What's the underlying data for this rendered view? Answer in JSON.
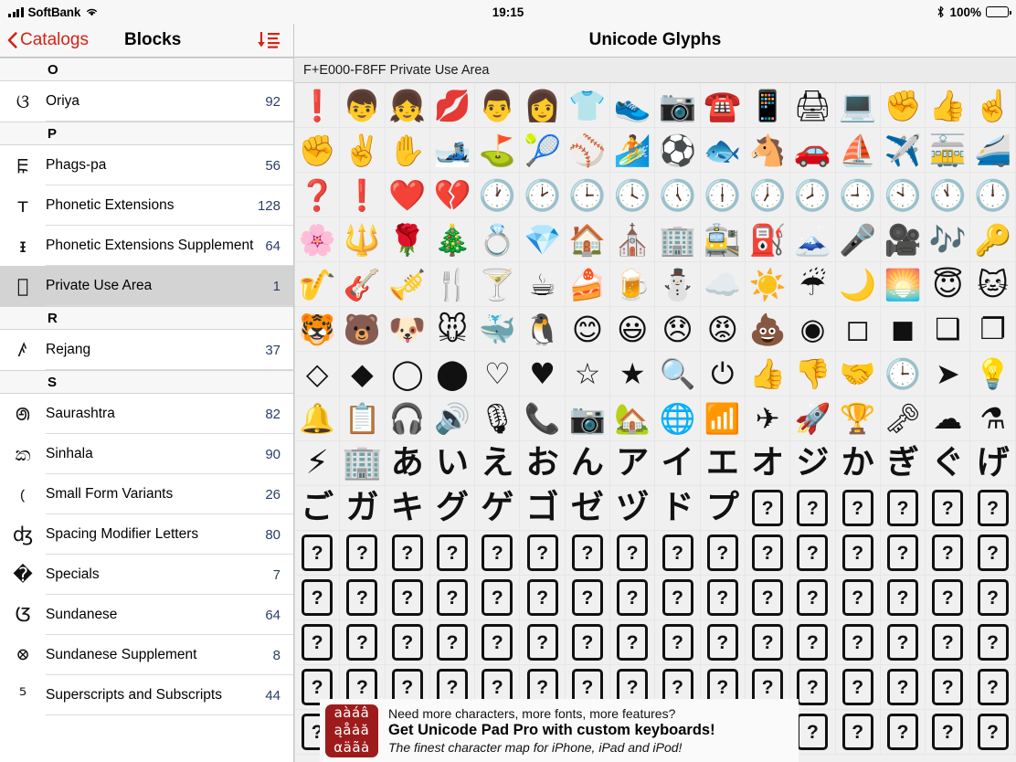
{
  "statusbar": {
    "signal_icon": "signal-bars-icon",
    "carrier": "SoftBank",
    "wifi_icon": "wifi-icon",
    "time": "19:15",
    "bluetooth_icon": "bluetooth-icon",
    "battery_percent": "100%",
    "battery_icon": "battery-full-icon"
  },
  "sidebar": {
    "back_label": "Catalogs",
    "back_icon": "chevron-left-icon",
    "title": "Blocks",
    "sort_icon": "sort-descending-icon",
    "sections": [
      {
        "letter": "O",
        "rows": [
          {
            "icon": "ଓ",
            "label": "Oriya",
            "count": "92",
            "selected": false
          }
        ]
      },
      {
        "letter": "P",
        "rows": [
          {
            "icon": "ꡀ",
            "label": "Phags-pa",
            "count": "56",
            "selected": false
          },
          {
            "icon": "ᴛ",
            "label": "Phonetic Extensions",
            "count": "128",
            "selected": false
          },
          {
            "icon": "ᵻ",
            "label": "Phonetic Extensions Supplement",
            "count": "64",
            "selected": false
          },
          {
            "icon": "",
            "label": "Private Use Area",
            "count": "1",
            "selected": true
          }
        ]
      },
      {
        "letter": "R",
        "rows": [
          {
            "icon": "ꤰ",
            "label": "Rejang",
            "count": "37",
            "selected": false
          }
        ]
      },
      {
        "letter": "S",
        "rows": [
          {
            "icon": "ꢠ",
            "label": "Saurashtra",
            "count": "82",
            "selected": false
          },
          {
            "icon": "ක",
            "label": "Sinhala",
            "count": "90",
            "selected": false
          },
          {
            "icon": "﹙",
            "label": "Small Form Variants",
            "count": "26",
            "selected": false
          },
          {
            "icon": "ʤ",
            "label": "Spacing Modifier Letters",
            "count": "80",
            "selected": false
          },
          {
            "icon": "�",
            "label": "Specials",
            "count": "7",
            "selected": false
          },
          {
            "icon": "ᮃ",
            "label": "Sundanese",
            "count": "64",
            "selected": false
          },
          {
            "icon": "᳁",
            "label": "Sundanese Supplement",
            "count": "8",
            "selected": false
          },
          {
            "icon": "⁵",
            "label": "Superscripts and Subscripts",
            "count": "44",
            "selected": false
          }
        ]
      }
    ]
  },
  "detail": {
    "title": "Unicode Glyphs",
    "block_header": "F+E000-F8FF Private Use Area",
    "columns": 16,
    "rows": 15,
    "glyphs": [
      {
        "ch": "❗",
        "style": "emoji",
        "name": "exclamation"
      },
      {
        "ch": "👦",
        "style": "emoji",
        "name": "boy"
      },
      {
        "ch": "👧",
        "style": "emoji",
        "name": "girl"
      },
      {
        "ch": "💋",
        "style": "emoji",
        "name": "kiss-mark"
      },
      {
        "ch": "👨",
        "style": "emoji",
        "name": "man"
      },
      {
        "ch": "👩",
        "style": "emoji",
        "name": "woman"
      },
      {
        "ch": "👕",
        "style": "emoji",
        "name": "t-shirt"
      },
      {
        "ch": "👟",
        "style": "emoji",
        "name": "running-shoe"
      },
      {
        "ch": "📷",
        "style": "emoji",
        "name": "camera"
      },
      {
        "ch": "☎️",
        "style": "emoji",
        "name": "telephone"
      },
      {
        "ch": "📱",
        "style": "emoji",
        "name": "mobile-phone"
      },
      {
        "ch": "🖨",
        "style": "emoji",
        "name": "printer"
      },
      {
        "ch": "💻",
        "style": "emoji",
        "name": "laptop"
      },
      {
        "ch": "✊",
        "style": "emoji",
        "name": "fist"
      },
      {
        "ch": "👍",
        "style": "emoji",
        "name": "thumbs-up"
      },
      {
        "ch": "☝️",
        "style": "emoji",
        "name": "index-pointing-up"
      },
      {
        "ch": "✊",
        "style": "emoji",
        "name": "raised-fist"
      },
      {
        "ch": "✌️",
        "style": "emoji",
        "name": "victory-hand"
      },
      {
        "ch": "✋",
        "style": "emoji",
        "name": "raised-hand"
      },
      {
        "ch": "🎿",
        "style": "emoji",
        "name": "skis"
      },
      {
        "ch": "⛳",
        "style": "emoji",
        "name": "golf-flag"
      },
      {
        "ch": "🎾",
        "style": "emoji",
        "name": "tennis-ball"
      },
      {
        "ch": "⚾",
        "style": "emoji",
        "name": "baseball"
      },
      {
        "ch": "🏄",
        "style": "emoji",
        "name": "surfer"
      },
      {
        "ch": "⚽",
        "style": "emoji",
        "name": "soccer-ball"
      },
      {
        "ch": "🐟",
        "style": "emoji",
        "name": "fish"
      },
      {
        "ch": "🐴",
        "style": "emoji",
        "name": "horse-face"
      },
      {
        "ch": "🚗",
        "style": "emoji",
        "name": "car"
      },
      {
        "ch": "⛵",
        "style": "emoji",
        "name": "sailboat"
      },
      {
        "ch": "✈️",
        "style": "emoji",
        "name": "airplane"
      },
      {
        "ch": "🚋",
        "style": "emoji",
        "name": "tram"
      },
      {
        "ch": "🚄",
        "style": "emoji",
        "name": "bullet-train"
      },
      {
        "ch": "❓",
        "style": "emoji",
        "name": "question-mark"
      },
      {
        "ch": "❗",
        "style": "emoji",
        "name": "exclamation-mark"
      },
      {
        "ch": "❤️",
        "style": "emoji",
        "name": "red-heart"
      },
      {
        "ch": "💔",
        "style": "emoji",
        "name": "broken-heart"
      },
      {
        "ch": "🕐",
        "style": "emoji",
        "name": "clock-one"
      },
      {
        "ch": "🕑",
        "style": "emoji",
        "name": "clock-two"
      },
      {
        "ch": "🕒",
        "style": "emoji",
        "name": "clock-three"
      },
      {
        "ch": "🕓",
        "style": "emoji",
        "name": "clock-four"
      },
      {
        "ch": "🕔",
        "style": "emoji",
        "name": "clock-five"
      },
      {
        "ch": "🕕",
        "style": "emoji",
        "name": "clock-six"
      },
      {
        "ch": "🕖",
        "style": "emoji",
        "name": "clock-seven"
      },
      {
        "ch": "🕗",
        "style": "emoji",
        "name": "clock-eight"
      },
      {
        "ch": "🕘",
        "style": "emoji",
        "name": "clock-nine"
      },
      {
        "ch": "🕙",
        "style": "emoji",
        "name": "clock-ten"
      },
      {
        "ch": "🕚",
        "style": "emoji",
        "name": "clock-eleven"
      },
      {
        "ch": "🕛",
        "style": "emoji",
        "name": "clock-twelve"
      },
      {
        "ch": "🌸",
        "style": "emoji",
        "name": "cherry-blossom"
      },
      {
        "ch": "🔱",
        "style": "emoji",
        "name": "trident"
      },
      {
        "ch": "🌹",
        "style": "emoji",
        "name": "rose"
      },
      {
        "ch": "🎄",
        "style": "emoji",
        "name": "christmas-tree"
      },
      {
        "ch": "💍",
        "style": "emoji",
        "name": "ring"
      },
      {
        "ch": "💎",
        "style": "emoji",
        "name": "gem-stone"
      },
      {
        "ch": "🏠",
        "style": "emoji",
        "name": "house"
      },
      {
        "ch": "⛪",
        "style": "emoji",
        "name": "church"
      },
      {
        "ch": "🏢",
        "style": "emoji",
        "name": "office-building"
      },
      {
        "ch": "🚉",
        "style": "emoji",
        "name": "station"
      },
      {
        "ch": "⛽",
        "style": "emoji",
        "name": "fuel-pump"
      },
      {
        "ch": "🗻",
        "style": "emoji",
        "name": "mount-fuji"
      },
      {
        "ch": "🎤",
        "style": "emoji",
        "name": "microphone"
      },
      {
        "ch": "🎥",
        "style": "emoji",
        "name": "movie-camera"
      },
      {
        "ch": "🎶",
        "style": "emoji",
        "name": "musical-notes"
      },
      {
        "ch": "🔑",
        "style": "emoji",
        "name": "key"
      },
      {
        "ch": "🎷",
        "style": "emoji",
        "name": "saxophone"
      },
      {
        "ch": "🎸",
        "style": "emoji",
        "name": "guitar"
      },
      {
        "ch": "🎺",
        "style": "emoji",
        "name": "trumpet"
      },
      {
        "ch": "🍴",
        "style": "emoji",
        "name": "fork-and-knife"
      },
      {
        "ch": "🍸",
        "style": "emoji",
        "name": "cocktail-glass"
      },
      {
        "ch": "☕",
        "style": "emoji",
        "name": "hot-beverage"
      },
      {
        "ch": "🍰",
        "style": "emoji",
        "name": "shortcake"
      },
      {
        "ch": "🍺",
        "style": "emoji",
        "name": "beer-mug"
      },
      {
        "ch": "⛄",
        "style": "emoji",
        "name": "snowman"
      },
      {
        "ch": "☁️",
        "style": "emoji",
        "name": "cloud"
      },
      {
        "ch": "☀️",
        "style": "emoji",
        "name": "sun"
      },
      {
        "ch": "☔",
        "style": "emoji",
        "name": "umbrella-with-rain"
      },
      {
        "ch": "🌙",
        "style": "emoji",
        "name": "crescent-moon"
      },
      {
        "ch": "🌅",
        "style": "emoji",
        "name": "sunrise"
      },
      {
        "ch": "😇",
        "style": "emoji",
        "name": "angel-face"
      },
      {
        "ch": "🐱",
        "style": "emoji",
        "name": "cat-face"
      },
      {
        "ch": "🐯",
        "style": "emoji",
        "name": "tiger-face"
      },
      {
        "ch": "🐻",
        "style": "emoji",
        "name": "bear-face"
      },
      {
        "ch": "🐶",
        "style": "emoji",
        "name": "dog-face"
      },
      {
        "ch": "🐭",
        "style": "emoji",
        "name": "mouse-face"
      },
      {
        "ch": "🐳",
        "style": "emoji",
        "name": "whale"
      },
      {
        "ch": "🐧",
        "style": "emoji",
        "name": "penguin"
      },
      {
        "ch": "😊",
        "style": "emoji",
        "name": "smiling-face"
      },
      {
        "ch": "😃",
        "style": "emoji",
        "name": "grinning-face"
      },
      {
        "ch": "😞",
        "style": "emoji",
        "name": "disappointed-face"
      },
      {
        "ch": "😡",
        "style": "emoji",
        "name": "angry-face"
      },
      {
        "ch": "💩",
        "style": "emoji",
        "name": "pile-of-poo"
      },
      {
        "ch": "◉",
        "style": "mono",
        "name": "fisheye"
      },
      {
        "ch": "◻",
        "style": "mono",
        "name": "white-square"
      },
      {
        "ch": "◼",
        "style": "mono",
        "name": "black-square"
      },
      {
        "ch": "❑",
        "style": "mono",
        "name": "white-shadowed-square"
      },
      {
        "ch": "❐",
        "style": "mono",
        "name": "black-shadowed-square"
      },
      {
        "ch": "◇",
        "style": "mono",
        "name": "white-diamond"
      },
      {
        "ch": "◆",
        "style": "mono",
        "name": "black-diamond"
      },
      {
        "ch": "◯",
        "style": "mono",
        "name": "large-circle"
      },
      {
        "ch": "⬤",
        "style": "mono",
        "name": "black-circle"
      },
      {
        "ch": "♡",
        "style": "mono",
        "name": "white-heart"
      },
      {
        "ch": "♥",
        "style": "mono",
        "name": "black-heart"
      },
      {
        "ch": "☆",
        "style": "mono",
        "name": "white-star"
      },
      {
        "ch": "★",
        "style": "mono",
        "name": "black-star"
      },
      {
        "ch": "🔍",
        "style": "mono",
        "name": "magnifying-glass"
      },
      {
        "ch": "⏻",
        "style": "mono",
        "name": "power-symbol"
      },
      {
        "ch": "👍",
        "style": "mono",
        "name": "thumbs-up-outline"
      },
      {
        "ch": "👎",
        "style": "mono",
        "name": "thumbs-down-outline"
      },
      {
        "ch": "🤝",
        "style": "mono",
        "name": "handshake"
      },
      {
        "ch": "🕒",
        "style": "mono",
        "name": "clock-outline"
      },
      {
        "ch": "➤",
        "style": "mono",
        "name": "paper-plane"
      },
      {
        "ch": "💡",
        "style": "mono",
        "name": "light-bulb"
      },
      {
        "ch": "🔔",
        "style": "mono",
        "name": "bell"
      },
      {
        "ch": "📋",
        "style": "mono",
        "name": "clipboard"
      },
      {
        "ch": "🎧",
        "style": "mono",
        "name": "headphones"
      },
      {
        "ch": "🔊",
        "style": "mono",
        "name": "speaker-high-volume"
      },
      {
        "ch": "🎙",
        "style": "mono",
        "name": "studio-microphone"
      },
      {
        "ch": "📞",
        "style": "mono",
        "name": "telephone-receiver"
      },
      {
        "ch": "📷",
        "style": "mono",
        "name": "camera-solid"
      },
      {
        "ch": "🏡",
        "style": "mono",
        "name": "home"
      },
      {
        "ch": "🌐",
        "style": "mono",
        "name": "globe"
      },
      {
        "ch": "📶",
        "style": "mono",
        "name": "wifi-signal"
      },
      {
        "ch": "✈",
        "style": "mono",
        "name": "airplane-solid"
      },
      {
        "ch": "🚀",
        "style": "mono",
        "name": "rocket"
      },
      {
        "ch": "🏆",
        "style": "mono",
        "name": "trophy"
      },
      {
        "ch": "🗝",
        "style": "mono",
        "name": "key-solid"
      },
      {
        "ch": "☁",
        "style": "mono",
        "name": "cloud-solid"
      },
      {
        "ch": "⚗",
        "style": "mono",
        "name": "flask"
      },
      {
        "ch": "⚡",
        "style": "jp",
        "name": "high-voltage"
      },
      {
        "ch": "🏢",
        "style": "jp",
        "name": "building-glyph"
      },
      {
        "ch": "あ",
        "style": "jp",
        "name": "hiragana-a"
      },
      {
        "ch": "い",
        "style": "jp",
        "name": "hiragana-i"
      },
      {
        "ch": "え",
        "style": "jp",
        "name": "hiragana-e"
      },
      {
        "ch": "お",
        "style": "jp",
        "name": "hiragana-o"
      },
      {
        "ch": "ん",
        "style": "jp",
        "name": "hiragana-n"
      },
      {
        "ch": "ア",
        "style": "jp",
        "name": "katakana-a"
      },
      {
        "ch": "イ",
        "style": "jp",
        "name": "katakana-i"
      },
      {
        "ch": "エ",
        "style": "jp",
        "name": "katakana-e"
      },
      {
        "ch": "オ",
        "style": "jp",
        "name": "katakana-o"
      },
      {
        "ch": "ジ",
        "style": "jp",
        "name": "katakana-ji"
      },
      {
        "ch": "か",
        "style": "jp",
        "name": "hiragana-ka"
      },
      {
        "ch": "ぎ",
        "style": "jp",
        "name": "hiragana-gi"
      },
      {
        "ch": "ぐ",
        "style": "jp",
        "name": "hiragana-gu"
      },
      {
        "ch": "げ",
        "style": "jp",
        "name": "hiragana-ge"
      },
      {
        "ch": "ご",
        "style": "jp",
        "name": "hiragana-go"
      },
      {
        "ch": "ガ",
        "style": "jp",
        "name": "katakana-ga"
      },
      {
        "ch": "キ",
        "style": "jp",
        "name": "katakana-ki"
      },
      {
        "ch": "グ",
        "style": "jp",
        "name": "katakana-gu"
      },
      {
        "ch": "ゲ",
        "style": "jp",
        "name": "katakana-ge"
      },
      {
        "ch": "ゴ",
        "style": "jp",
        "name": "katakana-go"
      },
      {
        "ch": "ゼ",
        "style": "jp",
        "name": "katakana-ze"
      },
      {
        "ch": "ヅ",
        "style": "jp",
        "name": "katakana-zu"
      },
      {
        "ch": "ド",
        "style": "jp",
        "name": "katakana-do"
      },
      {
        "ch": "プ",
        "style": "jp",
        "name": "katakana-pu"
      },
      {
        "ch": "?",
        "style": "tofu",
        "name": "missing-glyph"
      },
      {
        "ch": "?",
        "style": "tofu",
        "name": "missing-glyph"
      },
      {
        "ch": "?",
        "style": "tofu",
        "name": "missing-glyph"
      },
      {
        "ch": "?",
        "style": "tofu",
        "name": "missing-glyph"
      },
      {
        "ch": "?",
        "style": "tofu",
        "name": "missing-glyph"
      },
      {
        "ch": "?",
        "style": "tofu",
        "name": "missing-glyph"
      }
    ],
    "tofu_rows": 5,
    "tofu_char": "?"
  },
  "ad": {
    "logo_lines": [
      "aàáâ",
      "ąåȧă",
      "αäãȧ"
    ],
    "line1": "Need more characters, more fonts, more features?",
    "line2": "Get Unicode Pad Pro with custom keyboards!",
    "line3": "The finest character map for iPhone, iPad and iPod!",
    "brand_color": "#9e1b1b"
  }
}
